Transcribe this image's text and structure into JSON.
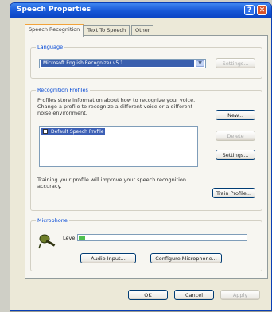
{
  "window": {
    "title": "Speech Properties",
    "help_glyph": "?",
    "close_glyph": "✕"
  },
  "tabs": [
    {
      "label": "Speech Recognition"
    },
    {
      "label": "Text To Speech"
    },
    {
      "label": "Other"
    }
  ],
  "language": {
    "group_label": "Language",
    "selected": "Microsoft English Recognizer v5.1",
    "settings_label": "Settings..."
  },
  "profiles": {
    "group_label": "Recognition Profiles",
    "description": "Profiles store information about how to recognize your voice. Change a profile to recognize a different voice or a different noise environment.",
    "items": [
      {
        "label": "Default Speech Profile",
        "checked": true
      }
    ],
    "new_label": "New...",
    "delete_label": "Delete",
    "settings_label": "Settings...",
    "training_text": "Training your profile will improve your speech recognition accuracy.",
    "train_label": "Train Profile..."
  },
  "microphone": {
    "group_label": "Microphone",
    "level_label": "Level",
    "level_fraction": 0.04,
    "audio_input_label": "Audio Input...",
    "configure_label": "Configure Microphone..."
  },
  "footer": {
    "ok_label": "OK",
    "cancel_label": "Cancel",
    "apply_label": "Apply"
  }
}
